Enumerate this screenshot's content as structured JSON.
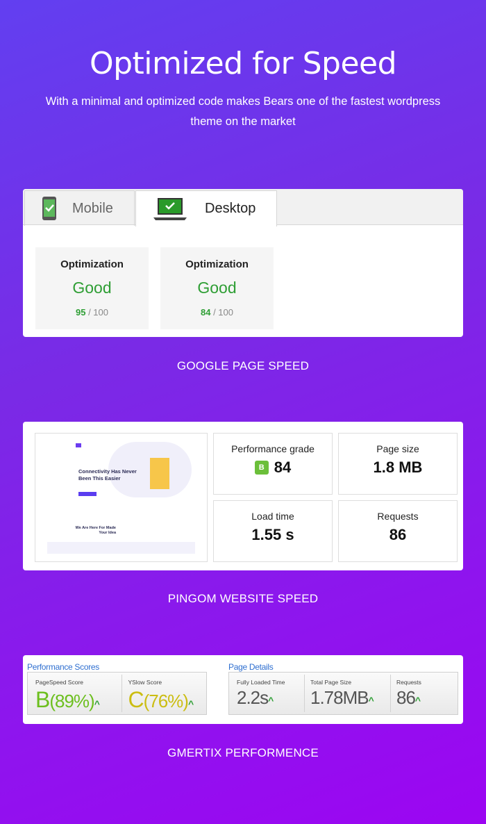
{
  "header": {
    "title": "Optimized for Speed",
    "subtitle": "With a minimal and optimized code makes Bears one of the fastest wordpress theme on the market"
  },
  "google": {
    "tabs": [
      {
        "label": "Mobile",
        "icon": "mobile-check-icon"
      },
      {
        "label": "Desktop",
        "icon": "laptop-check-icon",
        "active": true
      }
    ],
    "scores": [
      {
        "heading": "Optimization",
        "rating": "Good",
        "score": "95",
        "max": "/ 100"
      },
      {
        "heading": "Optimization",
        "rating": "Good",
        "score": "84",
        "max": "/ 100"
      }
    ],
    "caption": "GOOGLE PAGE SPEED"
  },
  "pingdom": {
    "preview": {
      "headline": "Connectivity Has Never Been This Easier",
      "section": "We Are Here For Made Your Idea"
    },
    "stats": [
      {
        "label": "Performance grade",
        "grade": "B",
        "value": "84"
      },
      {
        "label": "Page size",
        "value": "1.8 MB"
      },
      {
        "label": "Load time",
        "value": "1.55 s"
      },
      {
        "label": "Requests",
        "value": "86"
      }
    ],
    "caption": "PINGOM WEBSITE SPEED"
  },
  "gtmetrix": {
    "perf_title": "Performance Scores",
    "perf": [
      {
        "label": "PageSpeed Score",
        "grade": "B",
        "value": "(89%)",
        "color": "#6cbf1e"
      },
      {
        "label": "YSlow Score",
        "grade": "C",
        "value": "(76%)",
        "color": "#cbbd12"
      }
    ],
    "details_title": "Page Details",
    "details": [
      {
        "label": "Fully Loaded Time",
        "value": "2.2s"
      },
      {
        "label": "Total Page Size",
        "value": "1.78MB"
      },
      {
        "label": "Requests",
        "value": "86"
      }
    ],
    "caption": "GMERTIX PERFORMENCE"
  },
  "colors": {
    "good": "#2e9e34",
    "link": "#2f6fd0"
  }
}
